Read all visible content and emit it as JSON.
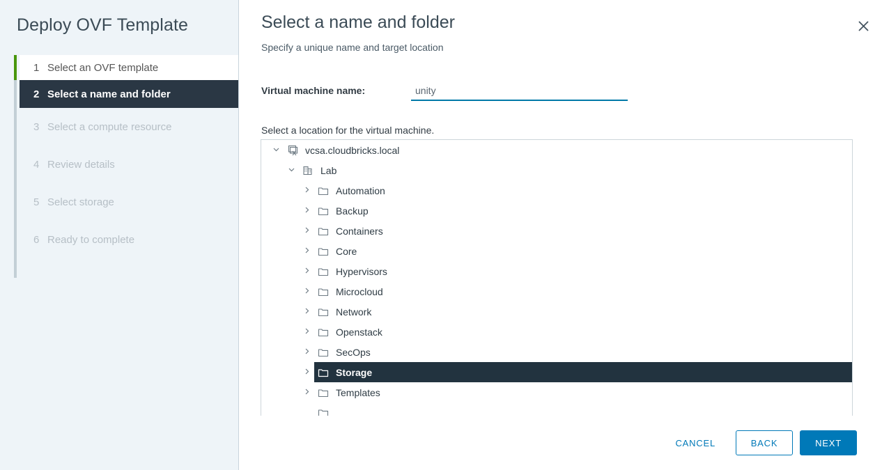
{
  "wizard": {
    "title": "Deploy OVF Template",
    "close_icon": "close-icon",
    "steps": [
      {
        "num": "1",
        "label": "Select an OVF template",
        "state": "done"
      },
      {
        "num": "2",
        "label": "Select a name and folder",
        "state": "active"
      },
      {
        "num": "3",
        "label": "Select a compute resource",
        "state": "pending"
      },
      {
        "num": "4",
        "label": "Review details",
        "state": "pending"
      },
      {
        "num": "5",
        "label": "Select storage",
        "state": "pending"
      },
      {
        "num": "6",
        "label": "Ready to complete",
        "state": "pending"
      }
    ]
  },
  "page": {
    "title": "Select a name and folder",
    "subtitle": "Specify a unique name and target location",
    "vm_name_label": "Virtual machine name:",
    "vm_name_value": "unity",
    "vm_name_placeholder": "Virtual machine name",
    "location_label": "Select a location for the virtual machine."
  },
  "tree": {
    "nodes": [
      {
        "label": "vcsa.cloudbricks.local",
        "icon": "vcenter-icon",
        "twisty": "chevron-down-icon",
        "depth": 0,
        "selected": false
      },
      {
        "label": "Lab",
        "icon": "datacenter-icon",
        "twisty": "chevron-down-icon",
        "depth": 1,
        "selected": false
      },
      {
        "label": "Automation",
        "icon": "folder-icon",
        "twisty": "chevron-right-icon",
        "depth": 2,
        "selected": false
      },
      {
        "label": "Backup",
        "icon": "folder-icon",
        "twisty": "chevron-right-icon",
        "depth": 2,
        "selected": false
      },
      {
        "label": "Containers",
        "icon": "folder-icon",
        "twisty": "chevron-right-icon",
        "depth": 2,
        "selected": false
      },
      {
        "label": "Core",
        "icon": "folder-icon",
        "twisty": "chevron-right-icon",
        "depth": 2,
        "selected": false
      },
      {
        "label": "Hypervisors",
        "icon": "folder-icon",
        "twisty": "chevron-right-icon",
        "depth": 2,
        "selected": false
      },
      {
        "label": "Microcloud",
        "icon": "folder-icon",
        "twisty": "chevron-right-icon",
        "depth": 2,
        "selected": false
      },
      {
        "label": "Network",
        "icon": "folder-icon",
        "twisty": "chevron-right-icon",
        "depth": 2,
        "selected": false
      },
      {
        "label": "Openstack",
        "icon": "folder-icon",
        "twisty": "chevron-right-icon",
        "depth": 2,
        "selected": false
      },
      {
        "label": "SecOps",
        "icon": "folder-icon",
        "twisty": "chevron-right-icon",
        "depth": 2,
        "selected": false
      },
      {
        "label": "Storage",
        "icon": "folder-icon",
        "twisty": "chevron-right-icon",
        "depth": 2,
        "selected": true
      },
      {
        "label": "Templates",
        "icon": "folder-icon",
        "twisty": "chevron-right-icon",
        "depth": 2,
        "selected": false
      },
      {
        "label": "",
        "icon": "folder-icon",
        "twisty": "chevron-right-icon",
        "depth": 2,
        "selected": false
      }
    ]
  },
  "footer": {
    "cancel_label": "CANCEL",
    "back_label": "BACK",
    "next_label": "NEXT"
  },
  "colors": {
    "accent": "#0079b8",
    "selection": "#22333f",
    "sidebar_bg": "#eef4f8",
    "step_done_bar": "#48960c",
    "input_underline": "#0079a8"
  }
}
